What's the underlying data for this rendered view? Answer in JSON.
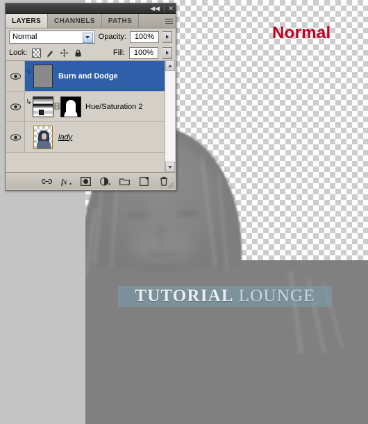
{
  "canvas": {
    "overlay_label": "Normal",
    "overlay_label_color": "#c00020",
    "watermark_bold": "TUTORIAL",
    "watermark_light": "LOUNGE"
  },
  "panel": {
    "titlebar": {
      "collapse_glyph": "◀◀",
      "close_glyph": "✕"
    },
    "tabs": [
      {
        "label": "LAYERS",
        "active": true
      },
      {
        "label": "CHANNELS",
        "active": false
      },
      {
        "label": "PATHS",
        "active": false
      }
    ],
    "menu_icon": "panel-menu-icon",
    "blend": {
      "mode": "Normal",
      "opacity_label": "Opacity:",
      "opacity_value": "100%"
    },
    "lock": {
      "label": "Lock:",
      "icons": [
        "lock-transparency-icon",
        "lock-image-pixels-icon",
        "lock-position-icon",
        "lock-all-icon"
      ],
      "fill_label": "Fill:",
      "fill_value": "100%"
    },
    "layers": [
      {
        "name": "Burn and Dodge",
        "selected": true,
        "visible": true,
        "clipped": true,
        "thumb_type": "gray"
      },
      {
        "name": "Hue/Saturation 2",
        "selected": false,
        "visible": true,
        "clipped": true,
        "thumb_type": "adjustment-with-mask"
      },
      {
        "name": "lady",
        "selected": false,
        "visible": true,
        "clipped": false,
        "thumb_type": "image"
      }
    ],
    "footer_icons": [
      "link-layers-icon",
      "layer-style-fx-icon",
      "layer-mask-icon",
      "adjustment-layer-icon",
      "new-group-icon",
      "new-layer-icon",
      "delete-layer-icon"
    ]
  }
}
